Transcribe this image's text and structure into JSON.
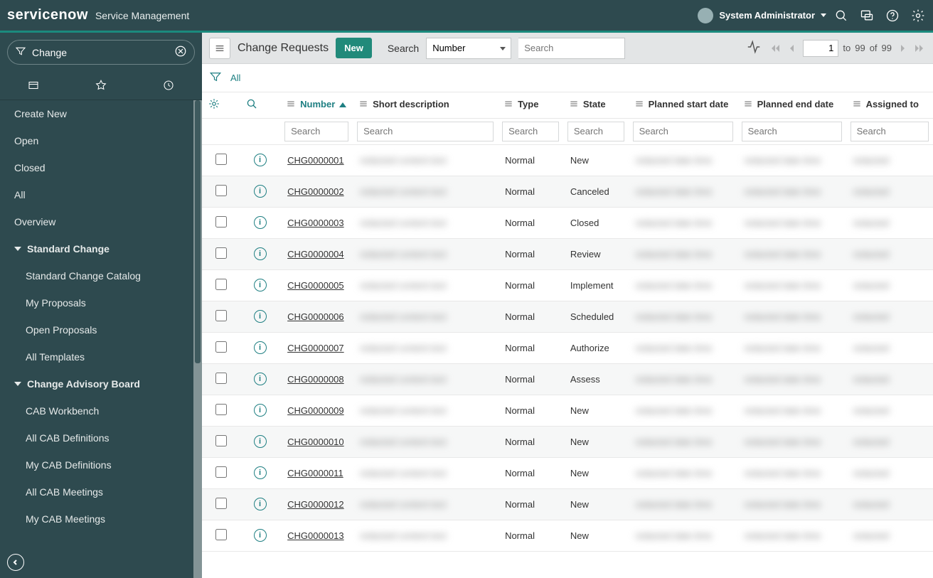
{
  "brand": {
    "name": "servicenow",
    "suffix": "Service Management"
  },
  "user": {
    "name": "System Administrator"
  },
  "leftnav": {
    "filter_value": "Change",
    "items": [
      {
        "label": "Create New"
      },
      {
        "label": "Open"
      },
      {
        "label": "Closed"
      },
      {
        "label": "All"
      },
      {
        "label": "Overview"
      },
      {
        "label": "Standard Change",
        "section": true
      },
      {
        "label": "Standard Change Catalog",
        "sub": true
      },
      {
        "label": "My Proposals",
        "sub": true
      },
      {
        "label": "Open Proposals",
        "sub": true
      },
      {
        "label": "All Templates",
        "sub": true
      },
      {
        "label": "Change Advisory Board",
        "section": true
      },
      {
        "label": "CAB Workbench",
        "sub": true
      },
      {
        "label": "All CAB Definitions",
        "sub": true
      },
      {
        "label": "My CAB Definitions",
        "sub": true
      },
      {
        "label": "All CAB Meetings",
        "sub": true
      },
      {
        "label": "My CAB Meetings",
        "sub": true
      }
    ]
  },
  "list_header": {
    "title": "Change Requests",
    "new_label": "New",
    "search_label": "Search",
    "search_field": "Number",
    "search_placeholder": "Search",
    "page_current": "1",
    "page_to": "to",
    "page_end": "99",
    "page_of": "of",
    "page_total": "99"
  },
  "breadcrumb": {
    "all": "All"
  },
  "table": {
    "columns": {
      "number": "Number",
      "short_desc": "Short description",
      "type": "Type",
      "state": "State",
      "planned_start": "Planned start date",
      "planned_end": "Planned end date",
      "assigned_to": "Assigned to"
    },
    "search_ph": "Search",
    "rows": [
      {
        "num": "CHG0000001",
        "type": "Normal",
        "state": "New"
      },
      {
        "num": "CHG0000002",
        "type": "Normal",
        "state": "Canceled"
      },
      {
        "num": "CHG0000003",
        "type": "Normal",
        "state": "Closed"
      },
      {
        "num": "CHG0000004",
        "type": "Normal",
        "state": "Review"
      },
      {
        "num": "CHG0000005",
        "type": "Normal",
        "state": "Implement"
      },
      {
        "num": "CHG0000006",
        "type": "Normal",
        "state": "Scheduled"
      },
      {
        "num": "CHG0000007",
        "type": "Normal",
        "state": "Authorize"
      },
      {
        "num": "CHG0000008",
        "type": "Normal",
        "state": "Assess"
      },
      {
        "num": "CHG0000009",
        "type": "Normal",
        "state": "New"
      },
      {
        "num": "CHG0000010",
        "type": "Normal",
        "state": "New"
      },
      {
        "num": "CHG0000011",
        "type": "Normal",
        "state": "New"
      },
      {
        "num": "CHG0000012",
        "type": "Normal",
        "state": "New"
      },
      {
        "num": "CHG0000013",
        "type": "Normal",
        "state": "New"
      }
    ]
  }
}
